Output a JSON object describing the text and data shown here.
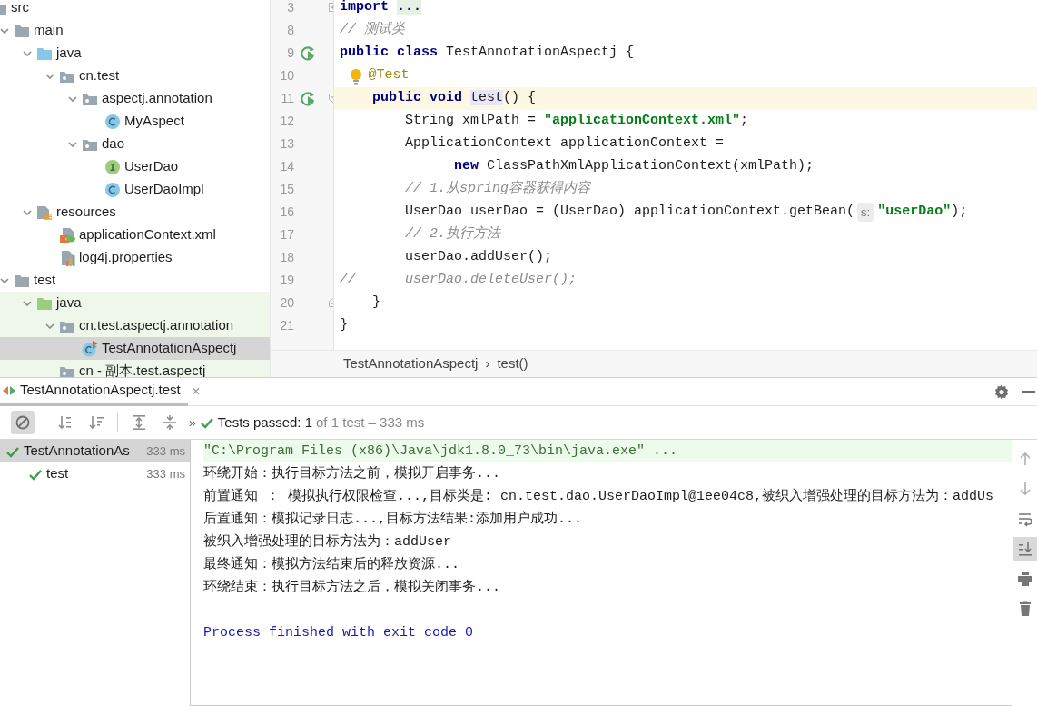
{
  "project_tree": {
    "items": [
      {
        "label": "src",
        "kind": "folder",
        "selected": false,
        "tinted": false,
        "children": [
          {
            "label": "main",
            "kind": "folder",
            "expanded": true,
            "selected": false,
            "tinted": false,
            "children": [
              {
                "label": "java",
                "kind": "source_folder",
                "expanded": true,
                "selected": false,
                "tinted": false,
                "children": [
                  {
                    "label": "cn.test",
                    "kind": "package",
                    "expanded": true,
                    "selected": false,
                    "tinted": false,
                    "children": [
                      {
                        "label": "aspectj.annotation",
                        "kind": "package",
                        "expanded": true,
                        "selected": false,
                        "tinted": false,
                        "children": [
                          {
                            "label": "MyAspect",
                            "kind": "class",
                            "selected": false,
                            "tinted": false
                          }
                        ]
                      },
                      {
                        "label": "dao",
                        "kind": "package",
                        "expanded": true,
                        "selected": false,
                        "tinted": false,
                        "children": [
                          {
                            "label": "UserDao",
                            "kind": "interface",
                            "selected": false,
                            "tinted": false
                          },
                          {
                            "label": "UserDaoImpl",
                            "kind": "class",
                            "selected": false,
                            "tinted": false
                          }
                        ]
                      }
                    ]
                  }
                ]
              },
              {
                "label": "resources",
                "kind": "resources",
                "expanded": true,
                "selected": false,
                "tinted": false,
                "children": [
                  {
                    "label": "applicationContext.xml",
                    "kind": "xml",
                    "selected": false,
                    "tinted": false
                  },
                  {
                    "label": "log4j.properties",
                    "kind": "properties",
                    "selected": false,
                    "tinted": false
                  }
                ]
              }
            ]
          },
          {
            "label": "test",
            "kind": "folder",
            "expanded": true,
            "selected": false,
            "tinted": false,
            "children": [
              {
                "label": "java",
                "kind": "test_folder",
                "expanded": true,
                "selected": false,
                "tinted": true,
                "children": [
                  {
                    "label": "cn.test.aspectj.annotation",
                    "kind": "package",
                    "expanded": true,
                    "selected": false,
                    "tinted": true,
                    "children": [
                      {
                        "label": "TestAnnotationAspectj",
                        "kind": "test_class",
                        "selected": true
                      }
                    ]
                  },
                  {
                    "label": "cn - 副本.test.aspectj",
                    "kind": "package",
                    "selected": false,
                    "tinted": true
                  }
                ]
              }
            ]
          }
        ]
      }
    ]
  },
  "editor": {
    "lines": [
      {
        "number": "3",
        "current": false,
        "gutter": [
          {
            "kind": "fold_expand"
          }
        ],
        "tokens": [
          {
            "kind": "keyword",
            "text": "import "
          },
          {
            "kind": "folded",
            "text": "..."
          }
        ]
      },
      {
        "number": "8",
        "current": false,
        "tokens": [
          {
            "kind": "comment",
            "text": "// 测试类"
          }
        ]
      },
      {
        "number": "9",
        "current": false,
        "gutter": [
          {
            "kind": "run"
          }
        ],
        "tokens": [
          {
            "kind": "keyword",
            "text": "public class"
          },
          {
            "kind": "plain",
            "text": " TestAnnotationAspectj {"
          }
        ]
      },
      {
        "number": "10",
        "current": false,
        "tokens": [
          {
            "kind": "bulb"
          },
          {
            "kind": "annotation",
            "text": "@Test"
          }
        ]
      },
      {
        "number": "11",
        "current": true,
        "gutter": [
          {
            "kind": "run"
          },
          {
            "kind": "fold"
          }
        ],
        "tokens": [
          {
            "kind": "keyword",
            "text": "    public void "
          },
          {
            "kind": "usage",
            "text": "test"
          },
          {
            "kind": "plain",
            "text": "() {"
          }
        ]
      },
      {
        "number": "12",
        "current": false,
        "tokens": [
          {
            "kind": "plain",
            "text": "        String xmlPath = "
          },
          {
            "kind": "string",
            "text": "\"applicationContext.xml\""
          },
          {
            "kind": "plain",
            "text": ";"
          }
        ]
      },
      {
        "number": "13",
        "current": false,
        "tokens": [
          {
            "kind": "plain",
            "text": "        ApplicationContext applicationContext ="
          }
        ]
      },
      {
        "number": "14",
        "current": false,
        "tokens": [
          {
            "kind": "keyword",
            "text": "              new"
          },
          {
            "kind": "plain",
            "text": " ClassPathXmlApplicationContext(xmlPath);"
          }
        ]
      },
      {
        "number": "15",
        "current": false,
        "tokens": [
          {
            "kind": "comment",
            "text": "        // 1.从spring容器获得内容"
          }
        ]
      },
      {
        "number": "16",
        "current": false,
        "tokens": [
          {
            "kind": "plain",
            "text": "        UserDao userDao = (UserDao) applicationContext.getBean("
          },
          {
            "kind": "hint",
            "text": "s:"
          },
          {
            "kind": "string",
            "text": "\"userDao\""
          },
          {
            "kind": "plain",
            "text": ");"
          }
        ]
      },
      {
        "number": "17",
        "current": false,
        "tokens": [
          {
            "kind": "comment",
            "text": "        // 2.执行方法"
          }
        ]
      },
      {
        "number": "18",
        "current": false,
        "tokens": [
          {
            "kind": "plain",
            "text": "        userDao.addUser();"
          }
        ]
      },
      {
        "number": "19",
        "current": false,
        "tokens": [
          {
            "kind": "comment",
            "text": "//      userDao.deleteUser();"
          }
        ]
      },
      {
        "number": "20",
        "current": false,
        "gutter": [
          {
            "kind": "fold_end"
          }
        ],
        "tokens": [
          {
            "kind": "plain",
            "text": "    }"
          }
        ]
      },
      {
        "number": "21",
        "current": false,
        "tokens": [
          {
            "kind": "plain",
            "text": "}"
          }
        ]
      }
    ],
    "breadcrumb": [
      "TestAnnotationAspectj",
      "›",
      "test()"
    ]
  },
  "run_panel": {
    "tab": {
      "label": "TestAnnotationAspectj.test",
      "close": "×",
      "selected": true
    },
    "toolbar": {
      "buttons": [
        {
          "kind": "stop",
          "pressed": true
        },
        {
          "kind": "separator"
        },
        {
          "kind": "sort_alpha",
          "pressed": false
        },
        {
          "kind": "sort_duration",
          "pressed": false
        },
        {
          "kind": "separator"
        },
        {
          "kind": "expand_all",
          "pressed": false
        },
        {
          "kind": "collapse_all",
          "pressed": false
        }
      ],
      "overflow": "»",
      "passed": true,
      "status": "Tests passed: 1",
      "detail": "of 1 test – 333 ms"
    },
    "tests": [
      {
        "label": "TestAnnotationAs",
        "duration": "333 ms",
        "passed": true,
        "selected": true,
        "children": [
          {
            "label": "test",
            "duration": "333 ms",
            "passed": true,
            "selected": false
          }
        ]
      }
    ],
    "console": [
      {
        "kind": "command",
        "text": "\"C:\\Program Files (x86)\\Java\\jdk1.8.0_73\\bin\\java.exe\" ..."
      },
      {
        "kind": "output",
        "text": "环绕开始：执行目标方法之前，模拟开启事务..."
      },
      {
        "kind": "output",
        "text": "前置通知 ： 模拟执行权限检查...,目标类是: cn.test.dao.UserDaoImpl@1ee04c8,被织入增强处理的目标方法为：addUs"
      },
      {
        "kind": "output",
        "text": "后置通知：模拟记录日志...,目标方法结果:添加用户成功..."
      },
      {
        "kind": "output",
        "text": "被织入增强处理的目标方法为：addUser"
      },
      {
        "kind": "output",
        "text": "最终通知：模拟方法结束后的释放资源..."
      },
      {
        "kind": "output",
        "text": "环绕结束：执行目标方法之后，模拟关闭事务..."
      },
      {
        "kind": "exit",
        "text": "Process finished with exit code 0"
      }
    ],
    "side_tools": [
      {
        "kind": "up",
        "pressed": false
      },
      {
        "kind": "down",
        "pressed": false
      },
      {
        "kind": "wrap",
        "pressed": false
      },
      {
        "kind": "scroll_end",
        "pressed": true
      },
      {
        "kind": "print",
        "pressed": false
      },
      {
        "kind": "trash",
        "pressed": false
      }
    ]
  }
}
